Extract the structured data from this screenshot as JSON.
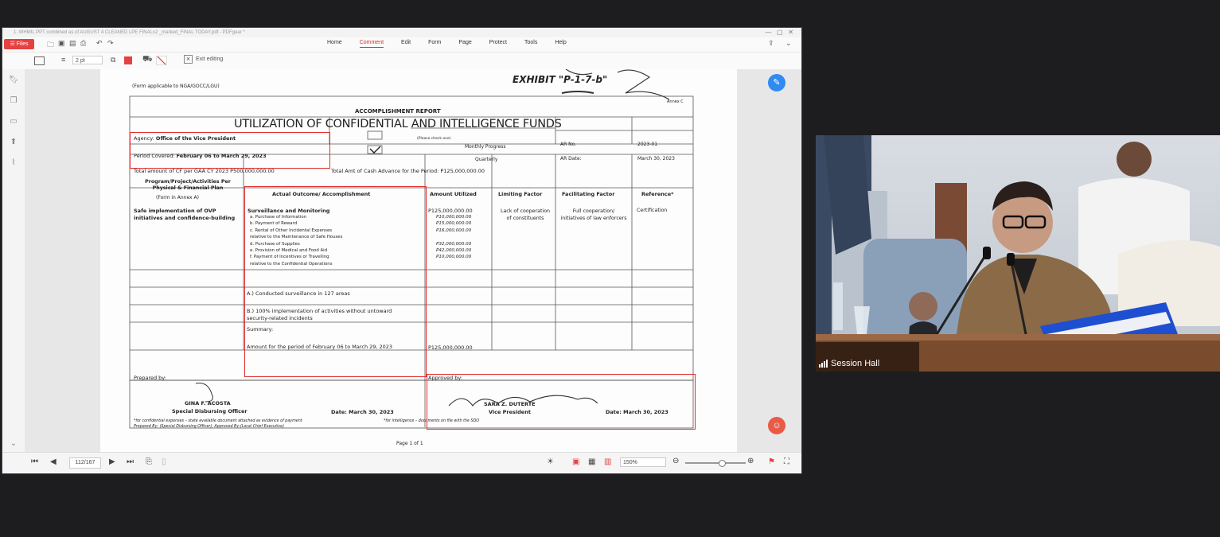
{
  "app": {
    "title": "1. WHMIL PPT combined as of AUGUST 4 CLEANED LPE FINALv2 _marked_FINAL TODAY.pdf - PDFgear *",
    "files_label": "Files",
    "menu": [
      "Home",
      "Comment",
      "Edit",
      "Form",
      "Page",
      "Protect",
      "Tools",
      "Help"
    ],
    "active_menu": "Comment",
    "stroke_size": "2 pt",
    "exit_editing": "Exit editing",
    "accent": "#e54141"
  },
  "status": {
    "page_input": "112/167",
    "zoom": "150%"
  },
  "doc": {
    "form_note": "(Form applicable to NGA/GOCC/LGU)",
    "exhibit": "EXHIBIT \"P-1-7-b\"",
    "annex": "Annex C",
    "report_title": "ACCOMPLISHMENT REPORT",
    "main_title": "UTILIZATION OF CONFIDENTIAL AND INTELLIGENCE FUNDS",
    "agency_label": "Agency:",
    "agency_value": "Office of the Vice President",
    "period_label": "Period Covered:",
    "period_value": "February 06 to March 29, 2023",
    "check_one": "(Please check one)",
    "monthly": "Monthly Progress",
    "quarterly": "Quarterly",
    "ar_no_label": "AR No.",
    "ar_no_value": "2023-01",
    "ar_date_label": "AR Date:",
    "ar_date_value": "March 30, 2023",
    "total_cf": "Total amount of CF per GAA CY 2023 P500,000,000.00",
    "total_advance": "Total Amt of Cash Advance for the Period: P125,000,000.00",
    "headers": {
      "program": "Program/Project/Activities Per Physical & Financial Plan",
      "program_sub": "(Form in Annex A)",
      "actual": "Actual Outcome/ Accomplishment",
      "amount": "Amount Utilized",
      "limiting": "Limiting Factor",
      "facilitating": "Facilitating Factor",
      "reference": "Reference*"
    },
    "program_text": "Safe implementation of OVP initiatives and confidence-building",
    "surveillance": "Surveillance and Monitoring",
    "items": [
      "a.  Purchase of Information",
      "b.  Payment of Reward",
      "c.  Rental of Other Incidental Expenses",
      "     relative to the Maintenance of Safe Houses",
      "d.  Purchase of Supplies",
      "e.  Provision of Medical and Food Aid",
      "f.  Payment of Incentives or Travelling",
      "     relative to the Confidential Operations"
    ],
    "amount_total": "P125,000,000.00",
    "amounts": [
      "P10,000,000.00",
      "P15,000,000.00",
      "P16,000,000.00",
      "",
      "P32,000,000.00",
      "P42,000,000.00",
      "P10,000,000.00",
      ""
    ],
    "limiting_text": "Lack of cooperation of constituents",
    "facilitating_text": "Full cooperation/ initiatives of law enforcers",
    "reference_text": "Certification",
    "surveil_line": "A.) Conducted surveillance in 127 areas",
    "impl_line": "B.) 100% implementation of activities without untoward security-related incidents",
    "summary_label": "Summary:",
    "summary_text": "Amount for the period of February 06 to March 29, 2023",
    "summary_amount": "P125,000,000.00",
    "prepared_by": "Prepared by:",
    "approved_by": "Approved by:",
    "preparer_name": "GINA F. ACOSTA",
    "preparer_title": "Special Disbursing Officer",
    "approver_name": "SARA Z. DUTERTE",
    "approver_title": "Vice President",
    "date_left": "Date: March 30, 2023",
    "date_right": "Date: March 30, 2023",
    "footnote1": "*for confidential expenses – state available document attached as evidence of payment",
    "footnote1b": "*for intelligence – documents on file with the SDO",
    "footnote2": "Prepared By: (Special Disbursing Officer); Approved By:(Local Chief Executive)",
    "page_of": "Page 1 of 1"
  },
  "video": {
    "label": "Session Hall"
  }
}
